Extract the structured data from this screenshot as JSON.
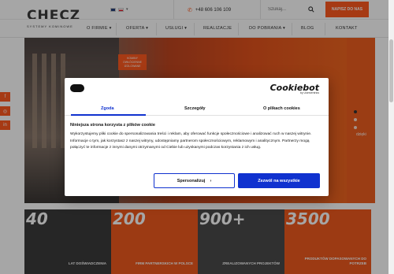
{
  "header": {
    "logo_text": "CHECZ",
    "logo_sub": "SYSTEMY KOMINOWE",
    "phone": "+48 606 106 109",
    "search_placeholder": "Szukaj...",
    "cta_label": "NAPISZ DO NAS"
  },
  "nav": {
    "items": [
      {
        "label": "O FIRMIE ▾"
      },
      {
        "label": "OFERTA ▾"
      },
      {
        "label": "USŁUGI ▾"
      },
      {
        "label": "REALIZACJE"
      },
      {
        "label": "DO POBRANIA ▾"
      },
      {
        "label": "BLOG"
      },
      {
        "label": "KONTAKT"
      }
    ]
  },
  "hero": {
    "tag": "KOMINY OWŁÓCIENNE IZOLOWANE",
    "side_text": "dzięki"
  },
  "stats": [
    {
      "number": "40",
      "label": "LAT DOŚWIADCZENIA"
    },
    {
      "number": "200",
      "label": "FIRM PARTNERSKICH W POLSCE"
    },
    {
      "number": "900+",
      "label": "ZREALIZOWANYCH PROJEKTÓW"
    },
    {
      "number": "3500",
      "label": "PRODUKTÓW DOPASOWANYCH DO POTRZEB"
    }
  ],
  "cookie": {
    "brand": "Cookiebot",
    "brand_sub": "by Usercentrics",
    "tabs": [
      "Zgoda",
      "Szczegóły",
      "O plikach cookies"
    ],
    "title": "Niniejsza strona korzysta z plików cookie",
    "text": "Wykorzystujemy pliki cookie do spersonalizowania treści i reklam, aby oferować funkcje społecznościowe i analizować ruch w naszej witrynie. Informacje o tym, jak korzystasz z naszej witryny, udostępniamy partnerom społecznościowym, reklamowym i analitycznym. Partnerzy mogą połączyć te informacje z innymi danymi otrzymanymi od Ciebie lub uzyskanymi podczas korzystania z ich usług.",
    "btn_customize": "Spersonalizuj",
    "btn_accept": "Zezwól na wszystkie"
  },
  "social": [
    "f",
    "◎",
    "in"
  ],
  "colors": {
    "accent": "#ff5a1f",
    "cookie_blue": "#1032cf"
  }
}
